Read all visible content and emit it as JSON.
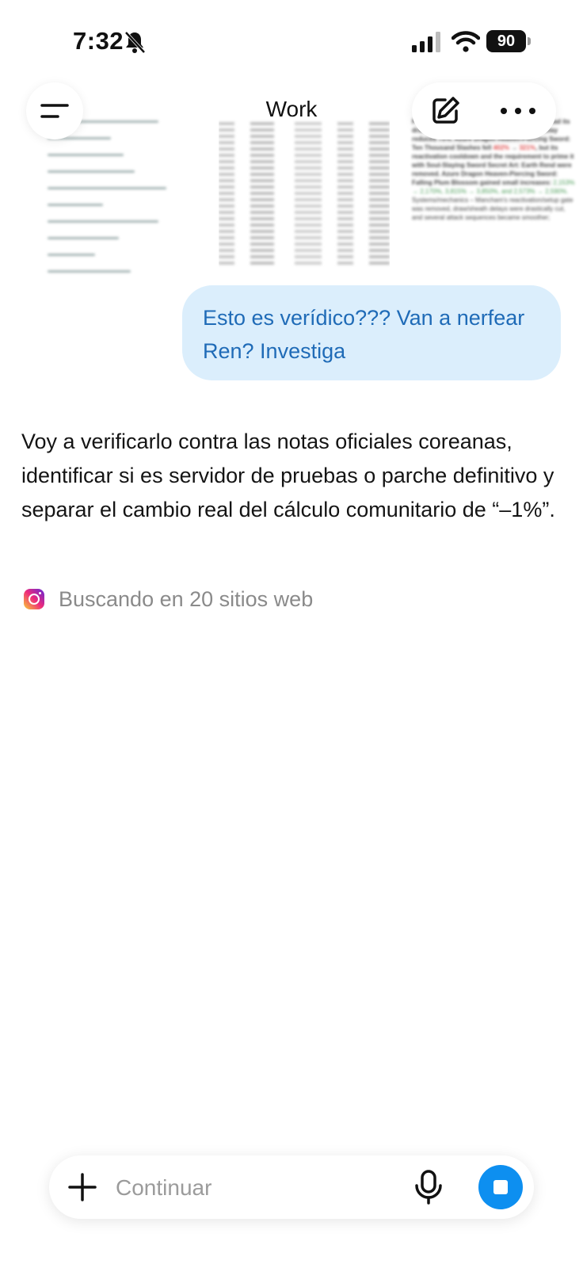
{
  "status_bar": {
    "time": "7:32",
    "battery": "90",
    "icons": [
      "bell-slash-icon",
      "cellular-signal-icon",
      "wifi-icon",
      "battery-icon"
    ]
  },
  "attachments": {
    "notes_preview": {
      "line1": "Plum Blossom Sword First Form: Flash Draw had its draw delay reduced about 67% and sheath delay reduced 75%. Azure Dragon Heaven-Piercing Sword: Ten Thousand Slashes fell",
      "old_value_1": "402%",
      "new_value_1": "321%",
      "line2": ", but its reactivation cooldown and the requirement to prime it with Soul-Slaying Sword Secret Art: Earth Rend were removed. Azure Dragon Heaven-Piercing Sword: Falling Plum Blossom gained small increases:",
      "gains": "2,153% → 2,170%, 3,815% → 3,850%, and 2,573% → 2,590%.",
      "line3": "Systems/mechanics – Mancham's reactivation/setup gate was removed, draw/sheath delays were drastically cut, and several attack sequences became smoother;"
    }
  },
  "header": {
    "title": "Work",
    "menu_icon": "hamburger-menu-icon",
    "edit_icon": "compose-edit-icon",
    "more_icon": "more-horizontal-icon"
  },
  "conversation": {
    "user_message": "Esto es verídico??? Van a nerfear Ren? Investiga",
    "assistant_message": "Voy a verificarlo contra las notas oficiales coreanas, identificar si es servidor de pruebas o parche definitivo y separar el cambio real del cálculo comunitario de “–1%”.",
    "searching_status": "Buscando en 20 sitios web",
    "searching_icon": "instagram-icon"
  },
  "composer": {
    "placeholder": "Continuar",
    "plus_icon": "plus-icon",
    "mic_icon": "microphone-icon",
    "stop_icon": "stop-icon",
    "accent": "#0d8ff0"
  },
  "colors": {
    "user_bubble_bg": "#dbeefc",
    "user_bubble_text": "#1f6bb7",
    "muted_text": "#8a8a8a"
  }
}
